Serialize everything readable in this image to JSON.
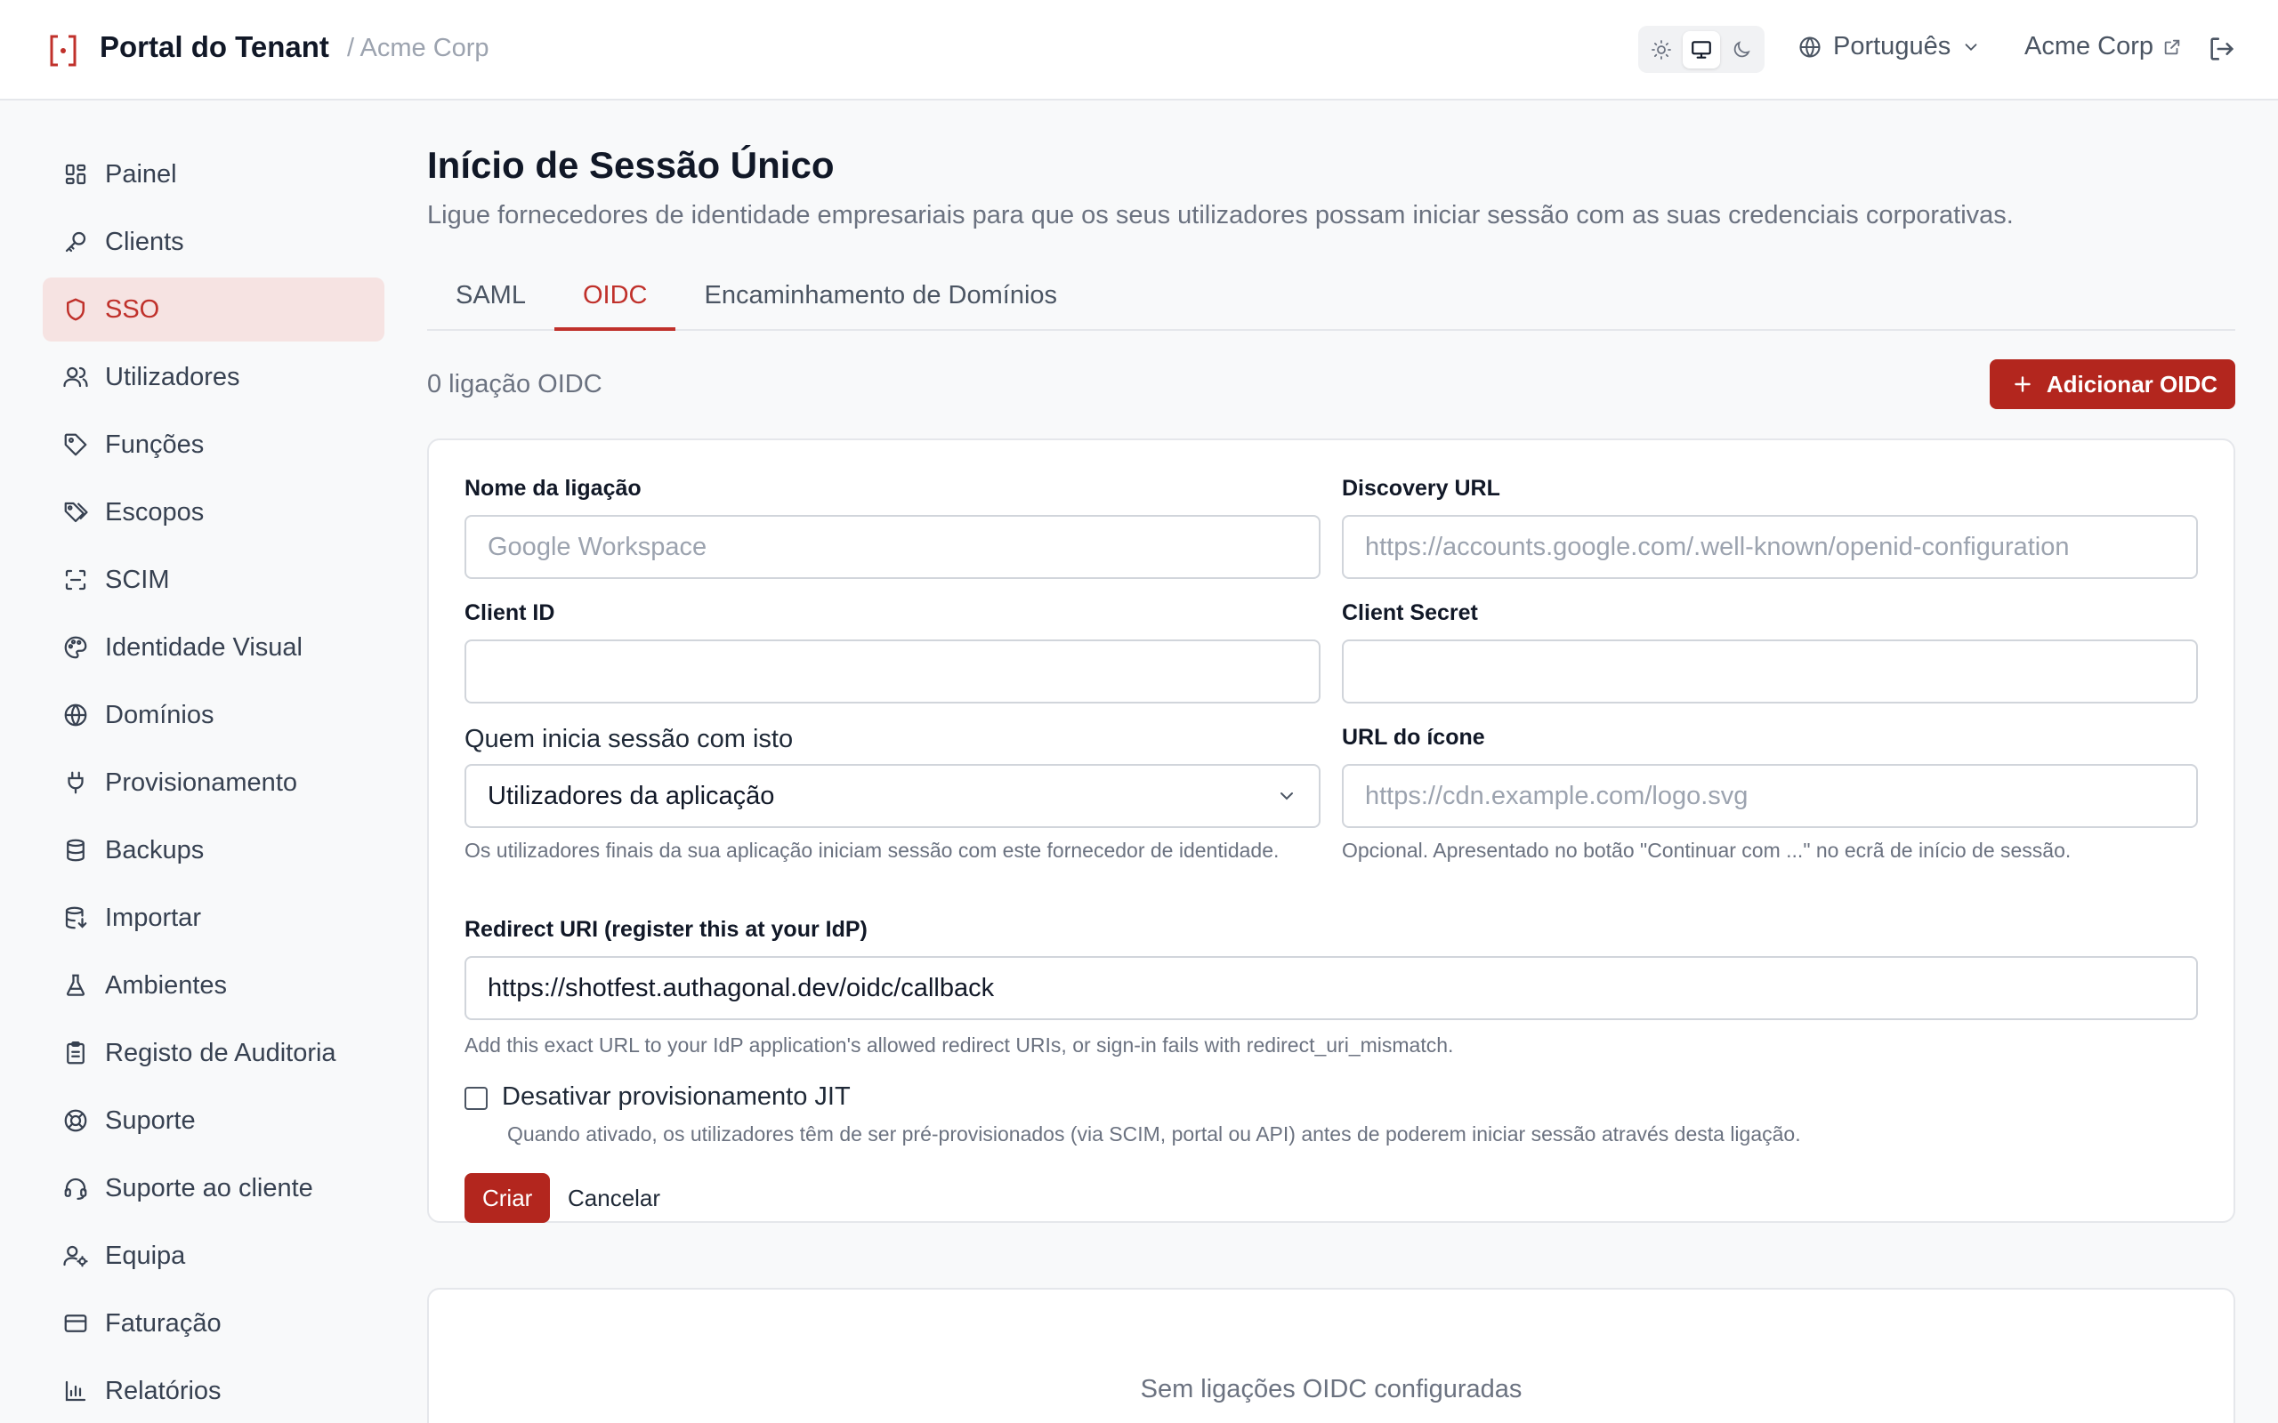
{
  "header": {
    "app_title": "Portal do Tenant",
    "tenant_crumb": "/ Acme Corp",
    "language": "Português",
    "org_name": "Acme Corp"
  },
  "sidebar": {
    "items": [
      {
        "label": "Painel",
        "icon": "dashboard-icon"
      },
      {
        "label": "Clients",
        "icon": "key-icon"
      },
      {
        "label": "SSO",
        "icon": "shield-icon",
        "active": true
      },
      {
        "label": "Utilizadores",
        "icon": "users-icon"
      },
      {
        "label": "Funções",
        "icon": "tag-icon"
      },
      {
        "label": "Escopos",
        "icon": "tags-icon"
      },
      {
        "label": "SCIM",
        "icon": "scan-icon"
      },
      {
        "label": "Identidade Visual",
        "icon": "palette-icon"
      },
      {
        "label": "Domínios",
        "icon": "globe-icon"
      },
      {
        "label": "Provisionamento",
        "icon": "plug-icon"
      },
      {
        "label": "Backups",
        "icon": "database-icon"
      },
      {
        "label": "Importar",
        "icon": "database-import-icon"
      },
      {
        "label": "Ambientes",
        "icon": "flask-icon"
      },
      {
        "label": "Registo de Auditoria",
        "icon": "clipboard-icon"
      },
      {
        "label": "Suporte",
        "icon": "lifebuoy-icon"
      },
      {
        "label": "Suporte ao cliente",
        "icon": "headset-icon"
      },
      {
        "label": "Equipa",
        "icon": "user-cog-icon"
      },
      {
        "label": "Faturação",
        "icon": "credit-card-icon"
      },
      {
        "label": "Relatórios",
        "icon": "bar-chart-icon"
      }
    ]
  },
  "page": {
    "title": "Início de Sessão Único",
    "subtitle": "Ligue fornecedores de identidade empresariais para que os seus utilizadores possam iniciar sessão com as suas credenciais corporativas.",
    "tabs": [
      {
        "label": "SAML"
      },
      {
        "label": "OIDC",
        "active": true
      },
      {
        "label": "Encaminhamento de Domínios"
      }
    ],
    "connection_count": "0 ligação OIDC",
    "add_button": "Adicionar OIDC"
  },
  "form": {
    "name_label": "Nome da ligação",
    "name_placeholder": "Google Workspace",
    "name_value": "",
    "discovery_label": "Discovery URL",
    "discovery_placeholder": "https://accounts.google.com/.well-known/openid-configuration",
    "discovery_value": "",
    "client_id_label": "Client ID",
    "client_id_value": "",
    "client_secret_label": "Client Secret",
    "client_secret_value": "",
    "audience_label": "Quem inicia sessão com isto",
    "audience_value": "Utilizadores da aplicação",
    "audience_help": "Os utilizadores finais da sua aplicação iniciam sessão com este fornecedor de identidade.",
    "icon_url_label": "URL do ícone",
    "icon_url_placeholder": "https://cdn.example.com/logo.svg",
    "icon_url_value": "",
    "icon_url_help": "Opcional. Apresentado no botão \"Continuar com ...\" no ecrã de início de sessão.",
    "redirect_label": "Redirect URI (register this at your IdP)",
    "redirect_value": "https://shotfest.authagonal.dev/oidc/callback",
    "redirect_help": "Add this exact URL to your IdP application's allowed redirect URIs, or sign-in fails with redirect_uri_mismatch.",
    "jit_label": "Desativar provisionamento JIT",
    "jit_checked": false,
    "jit_help": "Quando ativado, os utilizadores têm de ser pré-provisionados (via SCIM, portal ou API) antes de poderem iniciar sessão através desta ligação.",
    "create_button": "Criar",
    "cancel_button": "Cancelar"
  },
  "empty_state": {
    "text": "Sem ligações OIDC configuradas"
  },
  "colors": {
    "accent": "#b3261e",
    "accent_text": "#c0312b",
    "active_nav_bg": "#f6e3e2"
  }
}
